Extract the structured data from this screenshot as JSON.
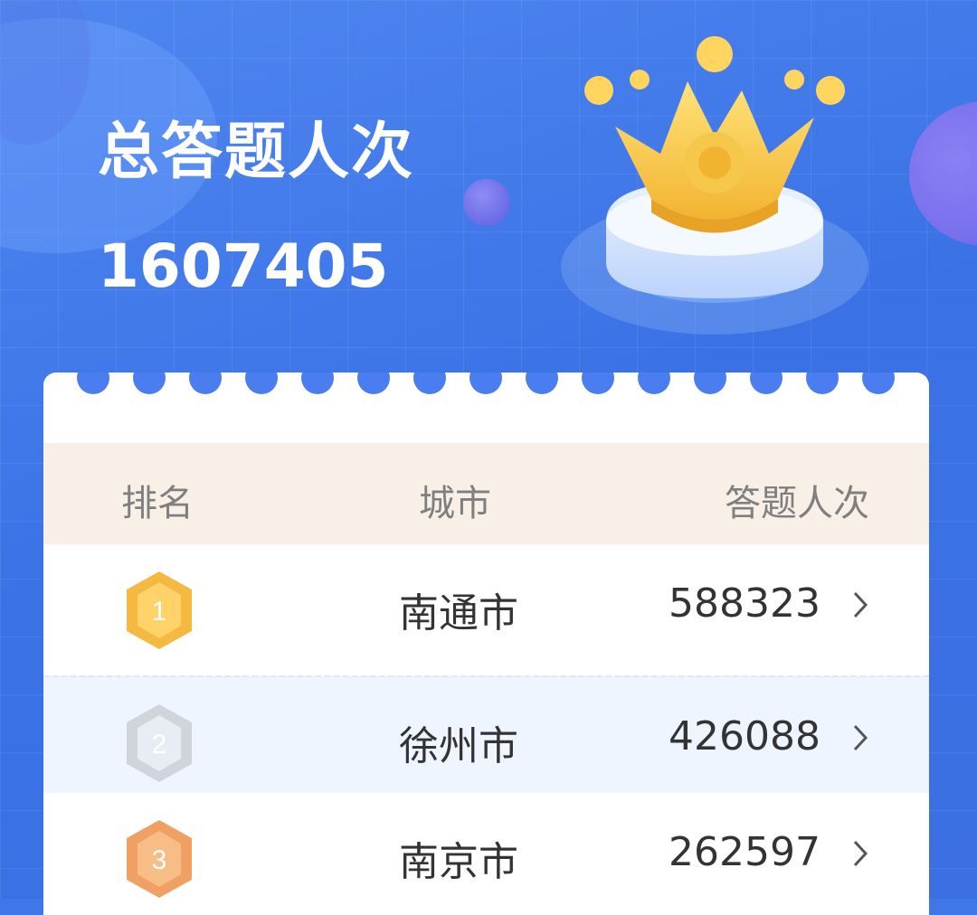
{
  "header": {
    "title": "总答题人次",
    "total_value": "1607405"
  },
  "table": {
    "headers": {
      "rank": "排名",
      "city": "城市",
      "count": "答题人次"
    },
    "rows": [
      {
        "rank": "1",
        "medal": "gold",
        "city": "南通市",
        "count": "588323"
      },
      {
        "rank": "2",
        "medal": "silver",
        "city": "徐州市",
        "count": "426088"
      },
      {
        "rank": "3",
        "medal": "bronze",
        "city": "南京市",
        "count": "262597"
      }
    ]
  },
  "colors": {
    "background": "#3f76e8",
    "header_row": "#f8efe7",
    "gold": "#f5b942",
    "silver": "#d7dbe3",
    "bronze": "#f0a062"
  },
  "icons": {
    "crown": "crown-icon",
    "row_arrow": "chevron-right-icon"
  }
}
